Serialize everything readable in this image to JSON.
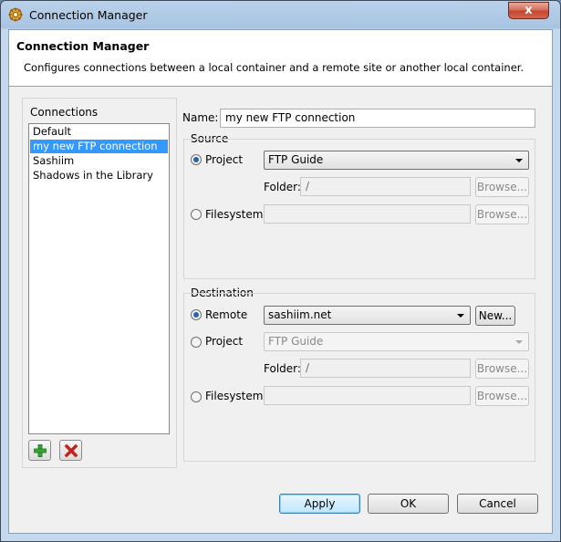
{
  "window": {
    "title": "Connection Manager",
    "close_glyph": "x",
    "icons": {
      "app": "gear-icon",
      "close": "close-icon"
    }
  },
  "banner": {
    "title": "Connection Manager",
    "description": "Configures connections between a local container and a remote site or another local container."
  },
  "connections": {
    "label": "Connections",
    "items": [
      {
        "label": "Default",
        "selected": false
      },
      {
        "label": "my new FTP connection",
        "selected": true
      },
      {
        "label": "Sashiim",
        "selected": false
      },
      {
        "label": "Shadows in the Library",
        "selected": false
      }
    ],
    "add_icon": "add-icon",
    "remove_icon": "remove-icon"
  },
  "name": {
    "label": "Name:",
    "value": "my new FTP connection"
  },
  "source": {
    "label": "Source",
    "project_label": "Project",
    "project_value": "FTP Guide",
    "folder_label": "Folder:",
    "folder_value": "/",
    "browse_label": "Browse...",
    "filesystem_label": "Filesystem",
    "filesystem_value": "",
    "selected": "project"
  },
  "destination": {
    "label": "Destination",
    "remote_label": "Remote",
    "remote_value": "sashiim.net",
    "new_label": "New...",
    "project_label": "Project",
    "project_value": "FTP Guide",
    "folder_label": "Folder:",
    "folder_value": "/",
    "browse_label": "Browse...",
    "filesystem_label": "Filesystem",
    "filesystem_value": "",
    "selected": "remote"
  },
  "footer": {
    "apply_label": "Apply",
    "ok_label": "OK",
    "cancel_label": "Cancel"
  },
  "colors": {
    "selection": "#3399ff",
    "radio_dot": "#2a62b0",
    "close_button": "#c3462f"
  }
}
